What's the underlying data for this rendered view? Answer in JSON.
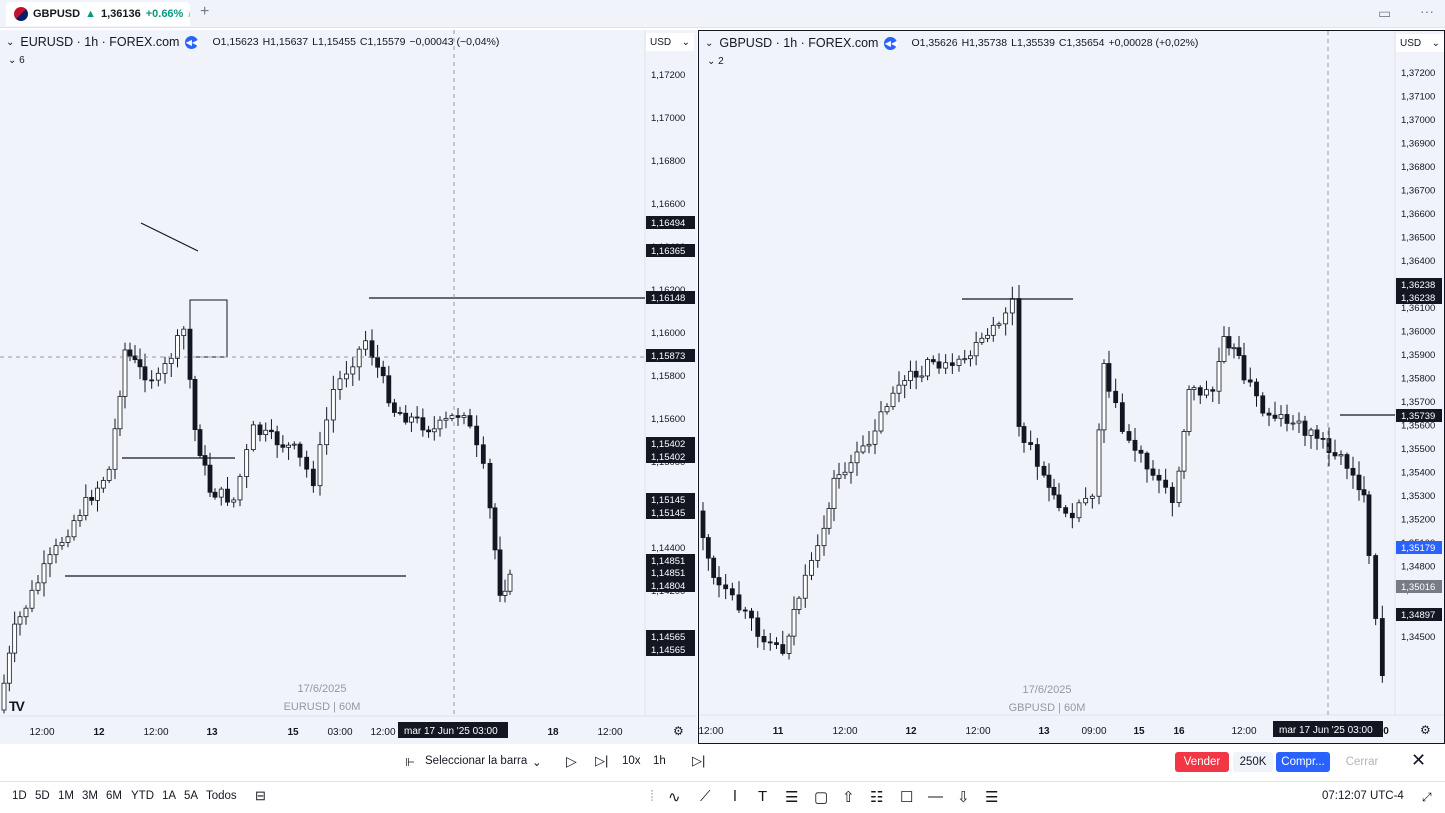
{
  "tab": {
    "symbol": "GBPUSD",
    "arrow": "▲",
    "price": "1,36136",
    "change": "+0.66%",
    "name_fragment": "/ N"
  },
  "left_chart": {
    "legend": {
      "ticker": "EURUSD · 1h · FOREX.com",
      "open": "O1,15623",
      "high": "H1,15637",
      "low": "L1,15455",
      "close": "C1,15579",
      "change": "−0,00043 (−0,04%)"
    },
    "indicator_count": "6",
    "currency": "USD",
    "watermark_date": "17/6/2025",
    "watermark_symbol": "EURUSD | 60M",
    "price_axis": [
      "1,17200",
      "1,17000",
      "1,16800",
      "1,16600",
      "1,16400",
      "1,16200",
      "1,16000",
      "1,15800",
      "1,15600",
      "1,15000",
      "1,14600",
      "1,14400",
      "1,14200"
    ],
    "price_labels": [
      "1,16494",
      "1,16365",
      "1,16148",
      "1,15873",
      "1,15402",
      "1,15402",
      "1,15145",
      "1,15145",
      "1,14851",
      "1,14851",
      "1,14804",
      "1,14565",
      "1,14565"
    ],
    "time_axis": [
      "12:00",
      "12",
      "12:00",
      "13",
      "15",
      "03:00",
      "12:00",
      "18",
      "12:00"
    ],
    "crosshair_time": "mar 17 Jun '25   03:00"
  },
  "right_chart": {
    "legend": {
      "ticker": "GBPUSD · 1h · FOREX.com",
      "open": "O1,35626",
      "high": "H1,35738",
      "low": "L1,35539",
      "close": "C1,35654",
      "change": "+0,00028 (+0,02%)"
    },
    "indicator_count": "2",
    "currency": "USD",
    "watermark_date": "17/6/2025",
    "watermark_symbol": "GBPUSD | 60M",
    "price_axis": [
      "1,37200",
      "1,37100",
      "1,37000",
      "1,36900",
      "1,36800",
      "1,36700",
      "1,36600",
      "1,36500",
      "1,36400",
      "1,36200",
      "1,36100",
      "1,36000",
      "1,35900",
      "1,35800",
      "1,35700",
      "1,35600",
      "1,35500",
      "1,35400",
      "1,35300",
      "1,35200",
      "1,35100",
      "1,34800",
      "1,34700",
      "1,34600",
      "1,34500"
    ],
    "price_labels": [
      "1,36238",
      "1,36238",
      "1,35739",
      "1,35179",
      "1,35016",
      "1,34897"
    ],
    "time_axis": [
      "12:00",
      "11",
      "12:00",
      "12",
      "12:00",
      "13",
      "09:00",
      "15",
      "16",
      "12:00",
      "0"
    ],
    "crosshair_time": "mar 17 Jun '25   03:00"
  },
  "replay_bar": {
    "select_bar": "Seleccionar la barra",
    "speed": "10x",
    "interval": "1h"
  },
  "trading": {
    "sell": "Vender",
    "quantity": "250K",
    "buy": "Compr...",
    "close": "Cerrar"
  },
  "ranges": [
    "1D",
    "5D",
    "1M",
    "3M",
    "6M",
    "YTD",
    "1A",
    "5A",
    "Todos"
  ],
  "clock": "07:12:07 UTC-4",
  "icons": {
    "tab_logo": "gbp-flag-icon",
    "add_tab": "plus-icon",
    "layout": "layout-icon",
    "more": "more-icon",
    "replay_play": "play-icon",
    "replay_step": "step-forward-icon",
    "replay_exit": "exit-replay-icon",
    "settings": "settings-icon"
  },
  "colors": {
    "up": "#089981",
    "down": "#131722",
    "sell": "#f23645",
    "buy": "#2962ff",
    "highlight_label": "#2962ff"
  }
}
